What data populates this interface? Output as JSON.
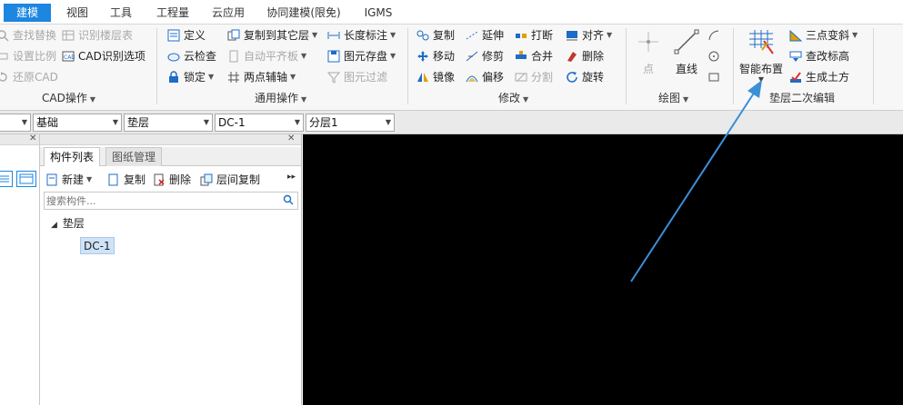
{
  "menu": {
    "items": [
      "建模",
      "视图",
      "工具",
      "工程量",
      "云应用",
      "协同建模(限免)",
      "IGMS"
    ],
    "active_color": "#1c86e0"
  },
  "ribbon": {
    "cad": {
      "find_replace": "查找替换",
      "identify_layer": "识别楼层表",
      "set_scale": "设置比例",
      "cad_options": "CAD识别选项",
      "restore_cad": "还原CAD",
      "group_label": "CAD操作"
    },
    "common": {
      "define": "定义",
      "copy_to_other_layer": "复制到其它层",
      "length_dim": "长度标注",
      "cloud_check": "云检查",
      "auto_plane": "自动平齐板",
      "element_save": "图元存盘",
      "lock": "锁定",
      "two_point_axis": "两点辅轴",
      "element_filter": "图元过滤",
      "group_label": "通用操作"
    },
    "modify": {
      "copy": "复制",
      "extend": "延伸",
      "break": "打断",
      "align": "对齐",
      "move": "移动",
      "trim": "修剪",
      "merge": "合并",
      "delete": "删除",
      "mirror": "镜像",
      "offset": "偏移",
      "split": "分割",
      "rotate": "旋转",
      "group_label": "修改"
    },
    "draw": {
      "point": "点",
      "line": "直线",
      "group_label": "绘图"
    },
    "cushion": {
      "smart_layout": "智能布置",
      "three_point_slope": "三点变斜",
      "check_elevation": "查改标高",
      "gen_earthwork": "生成土方",
      "group_label": "垫层二次编辑"
    }
  },
  "selectors": {
    "floor": "",
    "category": "基础",
    "type": "垫层",
    "component": "DC-1",
    "sublayer": "分层1"
  },
  "component_panel": {
    "tab_list": "构件列表",
    "tab_drawings": "图纸管理",
    "new": "新建",
    "copy": "复制",
    "delete": "删除",
    "copy_between_floors": "层间复制",
    "search_placeholder": "搜索构件...",
    "tree_root": "垫层",
    "tree_child": "DC-1"
  },
  "colors": {
    "canvas": "#000000",
    "arrow": "#3a8fd8",
    "selected_item": "#cfe3f7"
  }
}
